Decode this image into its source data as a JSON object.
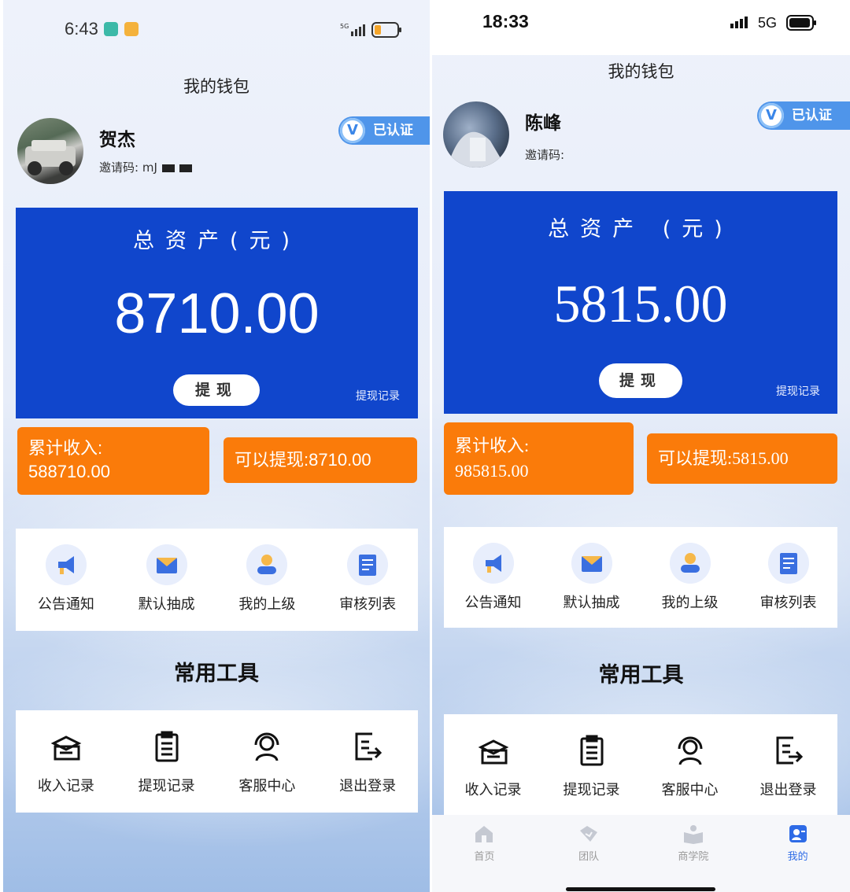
{
  "left": {
    "status": {
      "time": "6:43"
    },
    "page_title": "我的钱包",
    "profile": {
      "name": "贺杰",
      "invite_label": "邀请码:",
      "invite_code": "mJ"
    },
    "verified": "已认证",
    "asset": {
      "title": "总资产(元)",
      "amount": "8710.00",
      "withdraw_button": "提现",
      "withdraw_record_link": "提现记录"
    },
    "income": {
      "label": "累计收入:",
      "value": "588710.00"
    },
    "available": "可以提现:8710.00",
    "menu": [
      {
        "label": "公告通知",
        "icon": "megaphone-icon"
      },
      {
        "label": "默认抽成",
        "icon": "envelope-icon"
      },
      {
        "label": "我的上级",
        "icon": "person-icon"
      },
      {
        "label": "审核列表",
        "icon": "list-doc-icon"
      }
    ],
    "tools_title": "常用工具",
    "tools": [
      {
        "label": "收入记录",
        "icon": "income-record-icon"
      },
      {
        "label": "提现记录",
        "icon": "clipboard-icon"
      },
      {
        "label": "客服中心",
        "icon": "headset-icon"
      },
      {
        "label": "退出登录",
        "icon": "logout-doc-icon"
      }
    ]
  },
  "right": {
    "status": {
      "time": "18:33",
      "network": "5G"
    },
    "page_title": "我的钱包",
    "profile": {
      "name": "陈峰",
      "invite_label": "邀请码:"
    },
    "verified": "已认证",
    "asset": {
      "title": "总资产 (元)",
      "amount": "5815.00",
      "withdraw_button": "提现",
      "withdraw_record_link": "提现记录"
    },
    "income": {
      "label": "累计收入:",
      "value": "985815.00"
    },
    "available": "可以提现:5815.00",
    "menu": [
      {
        "label": "公告通知",
        "icon": "megaphone-icon"
      },
      {
        "label": "默认抽成",
        "icon": "envelope-icon"
      },
      {
        "label": "我的上级",
        "icon": "person-icon"
      },
      {
        "label": "审核列表",
        "icon": "list-doc-icon"
      }
    ],
    "tools_title": "常用工具",
    "tools": [
      {
        "label": "收入记录",
        "icon": "income-record-icon"
      },
      {
        "label": "提现记录",
        "icon": "clipboard-icon"
      },
      {
        "label": "客服中心",
        "icon": "headset-icon"
      },
      {
        "label": "退出登录",
        "icon": "logout-doc-icon"
      }
    ],
    "tabbar": [
      {
        "label": "首页",
        "icon": "home-icon",
        "active": false
      },
      {
        "label": "团队",
        "icon": "team-icon",
        "active": false
      },
      {
        "label": "商学院",
        "icon": "book-icon",
        "active": false
      },
      {
        "label": "我的",
        "icon": "profile-icon",
        "active": true
      }
    ]
  },
  "colors": {
    "primary_blue": "#1046cc",
    "orange": "#fa7b0a",
    "verified_blue": "#4f95ea",
    "tab_active": "#2e6be6"
  }
}
